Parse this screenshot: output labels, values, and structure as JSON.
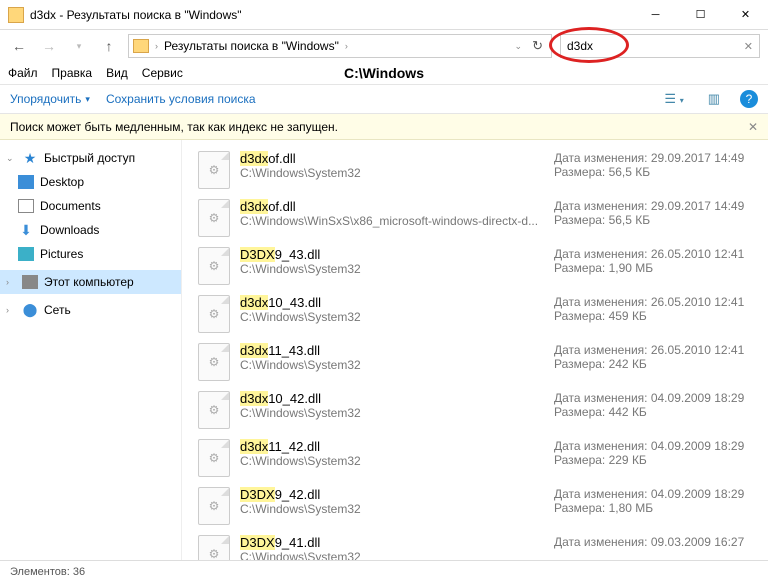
{
  "window": {
    "title": "d3dx - Результаты поиска в \"Windows\""
  },
  "nav": {
    "breadcrumb": "Результаты поиска в \"Windows\"",
    "search_value": "d3dx"
  },
  "menu": {
    "file": "Файл",
    "edit": "Правка",
    "view": "Вид",
    "service": "Сервис",
    "heading": "C:\\Windows"
  },
  "cmd": {
    "organize": "Упорядочить",
    "save_search": "Сохранить условия поиска"
  },
  "info": {
    "msg": "Поиск может быть медленным, так как индекс не запущен."
  },
  "sidebar": {
    "quick": "Быстрый доступ",
    "desktop": "Desktop",
    "documents": "Documents",
    "downloads": "Downloads",
    "pictures": "Pictures",
    "pc": "Этот компьютер",
    "network": "Сеть"
  },
  "meta_labels": {
    "date": "Дата изменения:",
    "size": "Размера:"
  },
  "results": [
    {
      "hl": "d3dx",
      "rest": "of.dll",
      "path": "C:\\Windows\\System32",
      "date": "29.09.2017 14:49",
      "size": "56,5 КБ"
    },
    {
      "hl": "d3dx",
      "rest": "of.dll",
      "path": "C:\\Windows\\WinSxS\\x86_microsoft-windows-directx-d...",
      "date": "29.09.2017 14:49",
      "size": "56,5 КБ"
    },
    {
      "hl": "D3DX",
      "rest": "9_43.dll",
      "path": "C:\\Windows\\System32",
      "date": "26.05.2010 12:41",
      "size": "1,90 МБ"
    },
    {
      "hl": "d3dx",
      "rest": "10_43.dll",
      "path": "C:\\Windows\\System32",
      "date": "26.05.2010 12:41",
      "size": "459 КБ"
    },
    {
      "hl": "d3dx",
      "rest": "11_43.dll",
      "path": "C:\\Windows\\System32",
      "date": "26.05.2010 12:41",
      "size": "242 КБ"
    },
    {
      "hl": "d3dx",
      "rest": "10_42.dll",
      "path": "C:\\Windows\\System32",
      "date": "04.09.2009 18:29",
      "size": "442 КБ"
    },
    {
      "hl": "d3dx",
      "rest": "11_42.dll",
      "path": "C:\\Windows\\System32",
      "date": "04.09.2009 18:29",
      "size": "229 КБ"
    },
    {
      "hl": "D3DX",
      "rest": "9_42.dll",
      "path": "C:\\Windows\\System32",
      "date": "04.09.2009 18:29",
      "size": "1,80 МБ"
    },
    {
      "hl": "D3DX",
      "rest": "9_41.dll",
      "path": "C:\\Windows\\System32",
      "date": "09.03.2009 16:27",
      "size": ""
    }
  ],
  "status": {
    "count": "Элементов: 36"
  }
}
